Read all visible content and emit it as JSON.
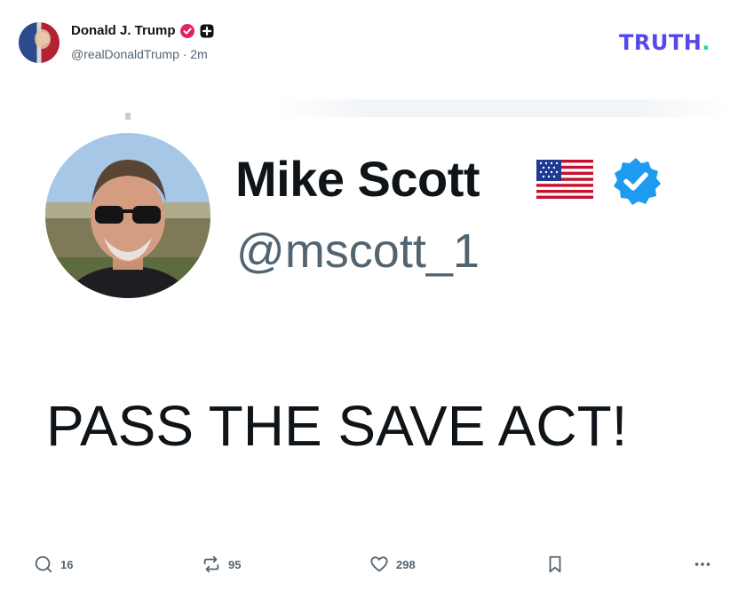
{
  "post": {
    "author": {
      "name": "Donald J. Trump",
      "handle": "@realDonaldTrump",
      "time": "· 2m",
      "avatar_icon": "profile-photo",
      "verified_icon": "verified-badge-icon",
      "plus_icon": "plus-badge-icon"
    },
    "brand": {
      "logo_text": "TRUTH",
      "logo_dot": ".",
      "color_primary": "#5448ee",
      "color_dot": "#14d4c3"
    },
    "embed": {
      "name": "Mike Scott",
      "handle": "@mscott_1",
      "flag_icon": "us-flag-icon",
      "verified_icon": "verified-badge-icon",
      "verified_color": "#1d9bf0",
      "text": "PASS THE SAVE ACT!"
    },
    "actions": {
      "replies": "16",
      "retruths": "95",
      "likes": "298"
    }
  }
}
